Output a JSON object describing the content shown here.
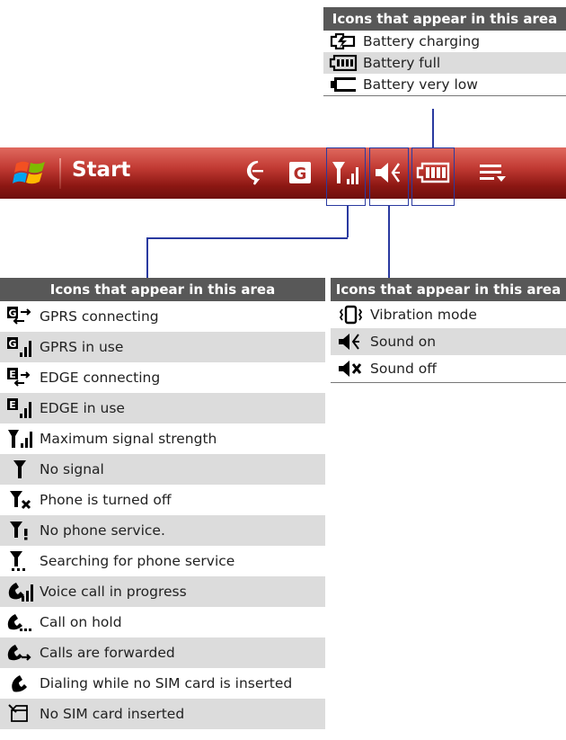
{
  "taskbar": {
    "start_label": "Start",
    "g_label": "G"
  },
  "battery_box": {
    "header": "Icons that appear in this area",
    "items": [
      {
        "icon": "battery-charging-icon",
        "label": "Battery charging"
      },
      {
        "icon": "battery-full-icon",
        "label": "Battery full"
      },
      {
        "icon": "battery-very-low-icon",
        "label": "Battery very low"
      }
    ]
  },
  "signal_box": {
    "header": "Icons that appear in this area",
    "items": [
      {
        "icon": "gprs-connecting-icon",
        "label": "GPRS connecting"
      },
      {
        "icon": "gprs-in-use-icon",
        "label": "GPRS in use"
      },
      {
        "icon": "edge-connecting-icon",
        "label": "EDGE connecting"
      },
      {
        "icon": "edge-in-use-icon",
        "label": "EDGE in use"
      },
      {
        "icon": "max-signal-icon",
        "label": "Maximum signal strength"
      },
      {
        "icon": "no-signal-icon",
        "label": "No signal"
      },
      {
        "icon": "phone-off-icon",
        "label": "Phone is turned off"
      },
      {
        "icon": "no-service-icon",
        "label": "No phone service."
      },
      {
        "icon": "searching-service-icon",
        "label": "Searching for phone service"
      },
      {
        "icon": "voice-call-icon",
        "label": "Voice call in progress"
      },
      {
        "icon": "call-hold-icon",
        "label": "Call on hold"
      },
      {
        "icon": "call-forward-icon",
        "label": "Calls are forwarded"
      },
      {
        "icon": "dialing-no-sim-icon",
        "label": "Dialing while no SIM card is inserted"
      },
      {
        "icon": "no-sim-icon",
        "label": "No SIM card inserted"
      }
    ]
  },
  "sound_box": {
    "header": "Icons that appear in this area",
    "items": [
      {
        "icon": "vibration-icon",
        "label": "Vibration mode"
      },
      {
        "icon": "sound-on-icon",
        "label": "Sound on"
      },
      {
        "icon": "sound-off-icon",
        "label": "Sound off"
      }
    ]
  },
  "colors": {
    "header_bg": "#585858",
    "row_shade": "#dcdcdc",
    "callout": "#2a3aa0",
    "taskbar": "#b3302a"
  }
}
